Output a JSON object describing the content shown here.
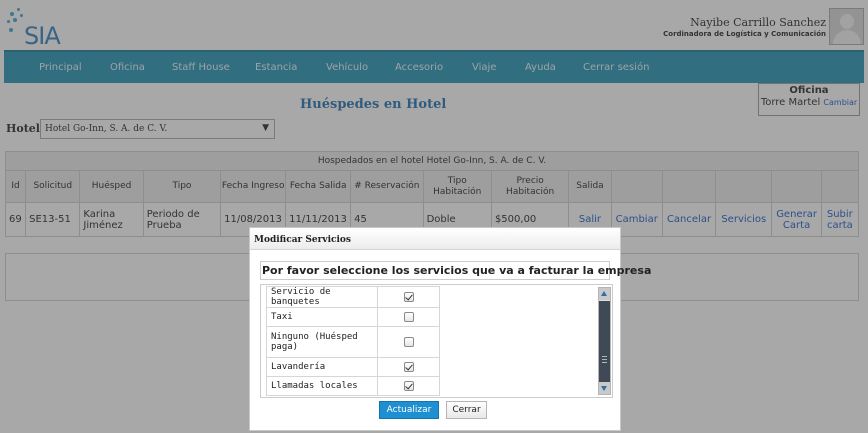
{
  "header": {
    "brand": "SIA",
    "user_name": "Nayibe Carrillo Sanchez",
    "user_role": "Cordinadora de Logística y Comunicación"
  },
  "nav": [
    "Principal",
    "Oficina",
    "Staff House",
    "Estancia",
    "Vehículo",
    "Accesorio",
    "Viaje",
    "Ayuda",
    "Cerrar sesión"
  ],
  "page": {
    "title": "Huéspedes en Hotel",
    "office_label": "Oficina",
    "office_value": "Torre Martel",
    "office_change": "Cambiar",
    "hotel_label": "Hotel:",
    "hotel_selected": "Hotel Go-Inn, S. A. de C. V."
  },
  "table": {
    "caption": "Hospedados en el hotel Hotel Go-Inn, S. A. de C. V.",
    "headers": [
      "Id",
      "Solicitud",
      "Huésped",
      "Tipo",
      "Fecha Ingreso",
      "Fecha Salida",
      "# Reservación",
      "Tipo Habitación",
      "Precio Habitación",
      "Salida",
      "",
      "",
      "",
      "",
      ""
    ],
    "row": {
      "id": "69",
      "solicitud": "SE13-51",
      "huesped": "Karina Jiménez",
      "tipo": "Periodo de Prueba",
      "fecha_ingreso": "11/08/2013",
      "fecha_salida": "11/11/2013",
      "reservacion": "45",
      "tipo_habitacion": "Doble",
      "precio": "$500,00",
      "salir": "Salir",
      "cambiar": "Cambiar",
      "cancelar": "Cancelar",
      "servicios": "Servicios",
      "generar_carta": "Generar Carta",
      "subir_carta": "Subir carta"
    }
  },
  "dialog": {
    "title": "Modificar Servicios",
    "heading": "Por favor seleccione los servicios que va a facturar la empresa",
    "services": [
      {
        "label": "Servicio de banquetes",
        "checked": true
      },
      {
        "label": "Taxi",
        "checked": false
      },
      {
        "label": "Ninguno (Huésped paga)",
        "checked": false
      },
      {
        "label": "Lavandería",
        "checked": true
      },
      {
        "label": "Llamadas locales",
        "checked": true
      }
    ],
    "update_label": "Actualizar",
    "close_label": "Cerrar"
  }
}
